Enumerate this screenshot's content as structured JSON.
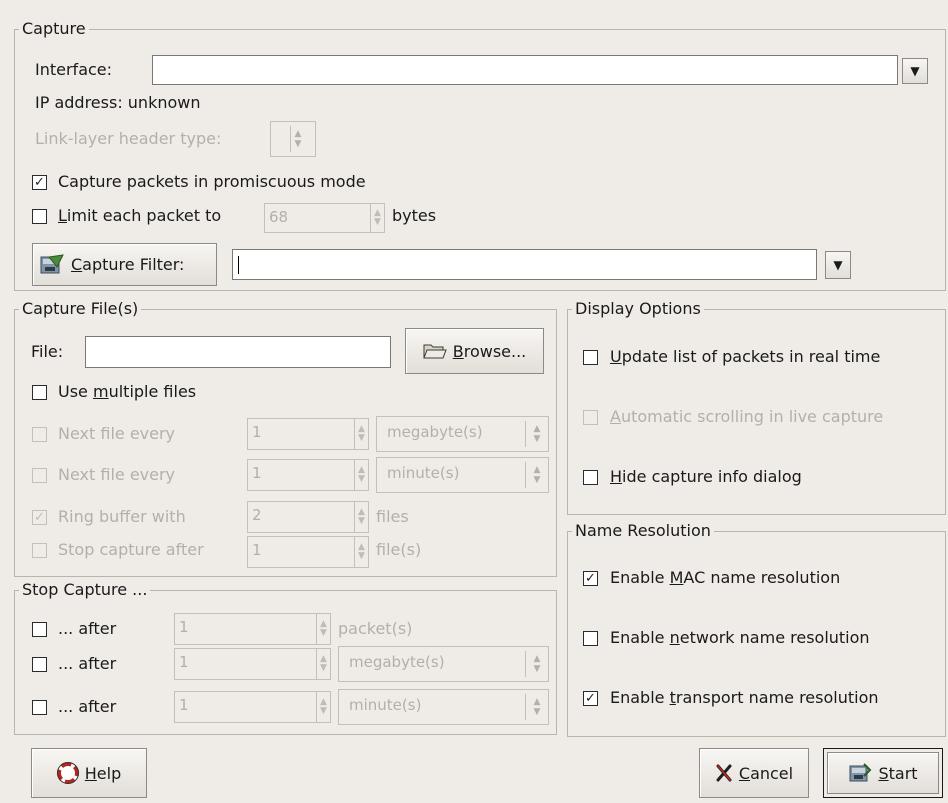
{
  "capture": {
    "title": "Capture",
    "interface_label": "Interface:",
    "interface_value": "",
    "ip_address": "IP address: unknown",
    "link_layer_label": "Link-layer header type:",
    "promiscuous": {
      "label": "Capture packets in promiscuous mode",
      "checked": true
    },
    "limit": {
      "label_pre": "L",
      "label_rest": "imit each packet to",
      "value": "68",
      "unit": "bytes",
      "checked": false
    },
    "filter_button": {
      "label_pre": "C",
      "label_rest": "apture Filter:"
    },
    "filter_value": ""
  },
  "capture_files": {
    "title": "Capture File(s)",
    "file_label": "File:",
    "file_value": "",
    "browse": {
      "label_pre": "B",
      "label_rest": "rowse..."
    },
    "use_multiple": {
      "label_pre": "Use ",
      "label_u": "m",
      "label_rest": "ultiple files",
      "checked": false
    },
    "next_size": {
      "label": "Next file every",
      "value": "1",
      "unit": "megabyte(s)"
    },
    "next_time": {
      "label": "Next file every",
      "value": "1",
      "unit": "minute(s)"
    },
    "ring": {
      "label": "Ring buffer with",
      "value": "2",
      "unit": "files"
    },
    "stop_after": {
      "label": "Stop capture after",
      "value": "1",
      "unit": "file(s)"
    }
  },
  "stop_capture": {
    "title": "Stop Capture ...",
    "rows": [
      {
        "label": "... after",
        "value": "1",
        "unit": "packet(s)"
      },
      {
        "label": "... after",
        "value": "1",
        "unit": "megabyte(s)"
      },
      {
        "label": "... after",
        "value": "1",
        "unit": "minute(s)"
      }
    ]
  },
  "display": {
    "title": "Display Options",
    "update": {
      "label_u": "U",
      "label_rest": "pdate list of packets in real time",
      "checked": false
    },
    "autoscroll": {
      "label_u": "A",
      "label_rest": "utomatic scrolling in live capture",
      "checked": false
    },
    "hide": {
      "label_u": "H",
      "label_rest": "ide capture info dialog",
      "checked": false
    }
  },
  "name_resolution": {
    "title": "Name Resolution",
    "mac": {
      "pre": "Enable ",
      "u": "M",
      "rest": "AC name resolution",
      "checked": true
    },
    "network": {
      "pre": "Enable ",
      "u": "n",
      "rest": "etwork name resolution",
      "checked": false
    },
    "transport": {
      "pre": "Enable ",
      "u": "t",
      "rest": "ransport name resolution",
      "checked": true
    }
  },
  "buttons": {
    "help": {
      "u": "H",
      "rest": "elp"
    },
    "cancel": {
      "u": "C",
      "rest": "ancel"
    },
    "start": {
      "u": "S",
      "rest": "tart"
    }
  },
  "icons": {
    "check": "✓",
    "dropdown": "▼",
    "spin_up": "▲",
    "spin_down": "▼"
  }
}
